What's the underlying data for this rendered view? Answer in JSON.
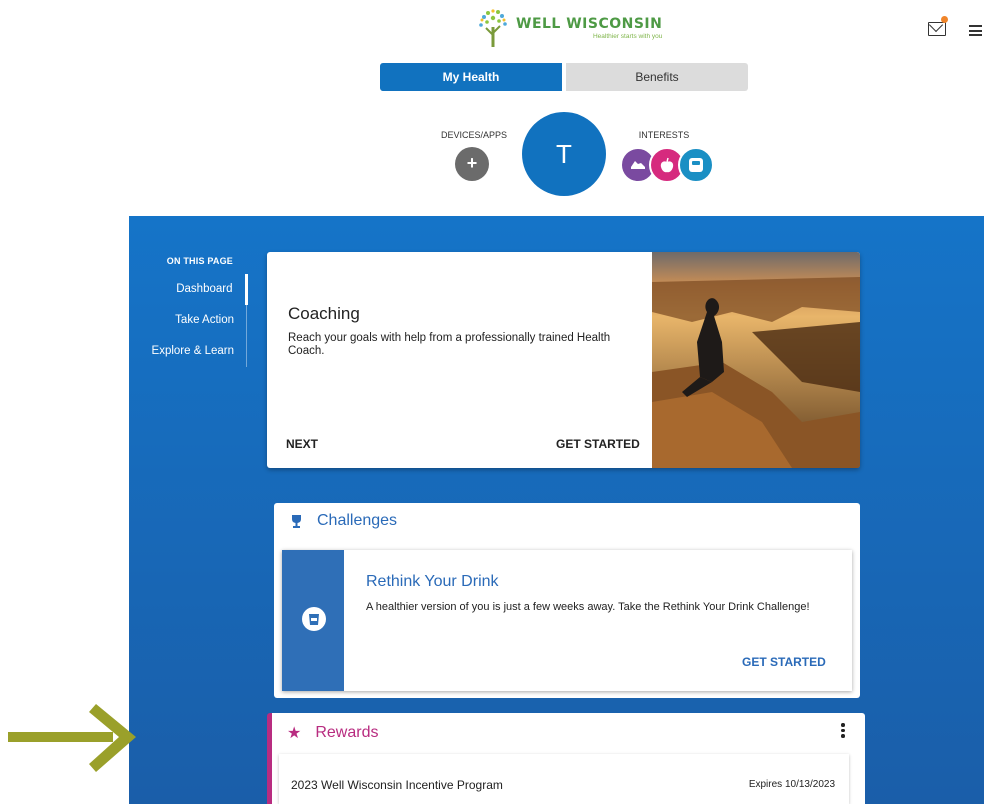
{
  "header": {
    "logo_name": "WELL WISCONSIN",
    "logo_tagline": "Healthier starts with you"
  },
  "tabs": [
    {
      "label": "My Health",
      "active": true
    },
    {
      "label": "Benefits",
      "active": false
    }
  ],
  "profile": {
    "devices_label": "DEVICES/APPS",
    "add_symbol": "+",
    "avatar_initial": "T",
    "interests_label": "INTERESTS"
  },
  "on_this_page": {
    "title": "ON THIS PAGE",
    "items": [
      "Dashboard",
      "Take Action",
      "Explore & Learn"
    ]
  },
  "coaching": {
    "title": "Coaching",
    "description": "Reach your goals with help from a professionally trained Health Coach.",
    "next_label": "NEXT",
    "start_label": "GET STARTED"
  },
  "challenges": {
    "title": "Challenges",
    "item_title": "Rethink Your Drink",
    "item_description": "A healthier version of you is just a few weeks away. Take the Rethink Your Drink Challenge!",
    "start_label": "GET STARTED"
  },
  "rewards": {
    "title": "Rewards",
    "program": "2023 Well Wisconsin Incentive Program",
    "expires": "Expires 10/13/2023"
  },
  "colors": {
    "primary_blue": "#1172bf",
    "rewards_magenta": "#b82c80",
    "annotation_arrow": "#9aa02a",
    "notification_dot": "#f0852a"
  }
}
